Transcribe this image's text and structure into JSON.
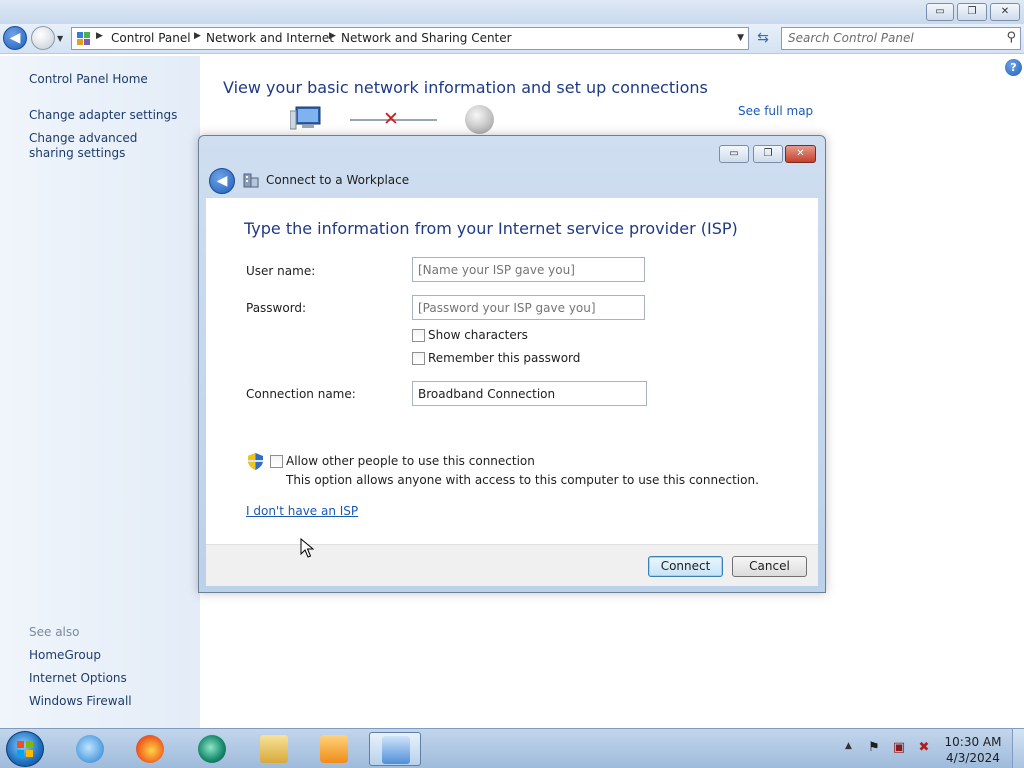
{
  "window": {
    "minimize_glyph": "▭",
    "maximize_glyph": "❐",
    "close_glyph": "✕"
  },
  "navigation": {
    "breadcrumb": [
      "Control Panel",
      "Network and Internet",
      "Network and Sharing Center"
    ],
    "search_placeholder": "Search Control Panel"
  },
  "sidebar": {
    "items": [
      {
        "label": "Control Panel Home"
      },
      {
        "label": "Change adapter settings"
      },
      {
        "label": "Change advanced sharing settings"
      }
    ],
    "see_also_header": "See also",
    "see_also_items": [
      {
        "label": "HomeGroup"
      },
      {
        "label": "Internet Options"
      },
      {
        "label": "Windows Firewall"
      }
    ]
  },
  "main": {
    "title": "View your basic network information and set up connections",
    "see_full_map": "See full map"
  },
  "dialog": {
    "title": "Connect to a Workplace",
    "heading": "Type the information from your Internet service provider (ISP)",
    "username_label": "User name:",
    "username_placeholder": "[Name your ISP gave you]",
    "password_label": "Password:",
    "password_placeholder": "[Password your ISP gave you]",
    "show_characters": "Show characters",
    "remember_password": "Remember this password",
    "connection_name_label": "Connection name:",
    "connection_name_value": "Broadband Connection",
    "allow_others": "Allow other people to use this connection",
    "allow_others_desc": "This option allows anyone with access to this computer to use this connection.",
    "no_isp_link": "I don't have an ISP",
    "connect_button": "Connect",
    "cancel_button": "Cancel"
  },
  "taskbar": {
    "apps": [
      "internet-explorer",
      "firefox",
      "app",
      "windows-explorer",
      "media-player",
      "control-panel"
    ],
    "clock_time": "10:30 AM",
    "clock_date": "4/3/2024"
  },
  "colors": {
    "link": "#1a5ab5",
    "heading": "#1e3a87",
    "close_red": "#c5412c"
  }
}
